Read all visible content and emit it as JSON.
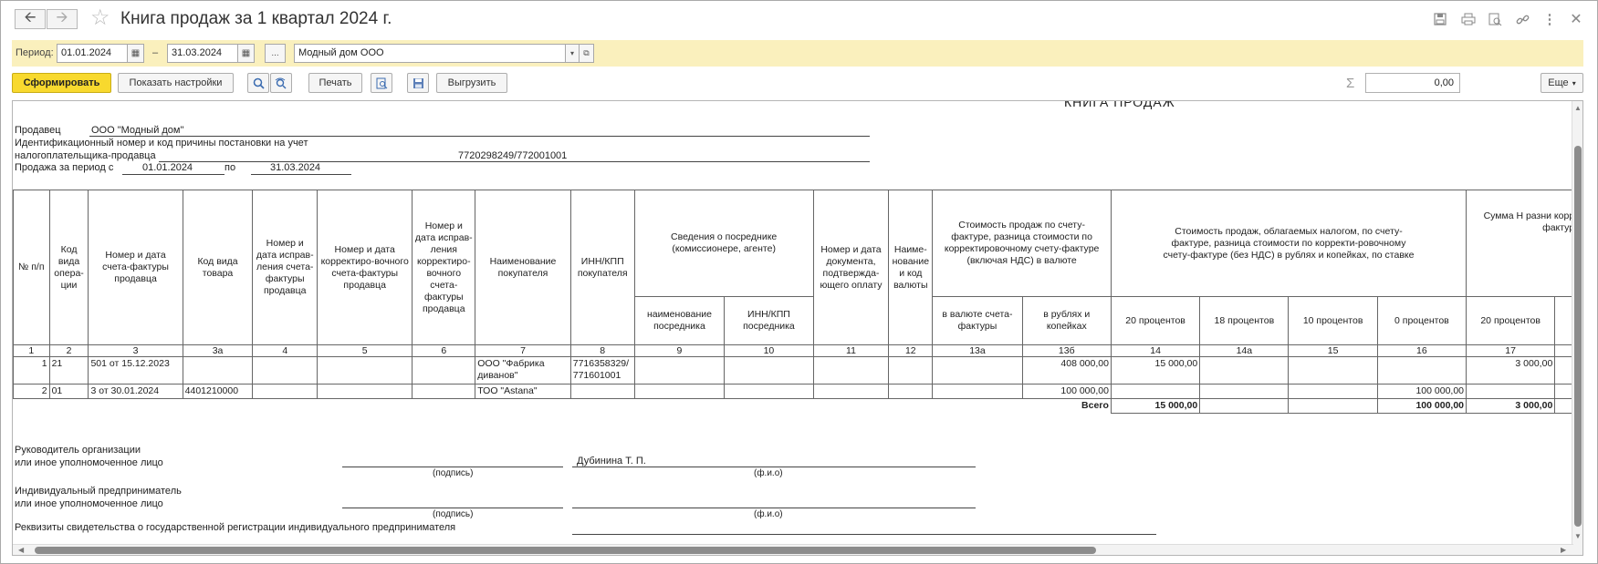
{
  "window": {
    "title": "Книга продаж за 1 квартал 2024 г."
  },
  "toolbar": {
    "back_icon": "arrow-left-icon",
    "forward_icon": "arrow-right-icon",
    "favorite_icon": "star-icon",
    "right_icons": [
      "save-icon",
      "print-icon",
      "preview-icon",
      "link-icon",
      "more-vertical-icon",
      "close-icon"
    ]
  },
  "period": {
    "label": "Период:",
    "from": "01.01.2024",
    "dash": "–",
    "to": "31.03.2024",
    "ellipsis": "...",
    "organization": "Модный дом ООО"
  },
  "actions": {
    "generate": "Сформировать",
    "show_settings": "Показать настройки",
    "print": "Печать",
    "export": "Выгрузить",
    "sum_value": "0,00",
    "more": "Еще"
  },
  "report": {
    "cut_title": "КНИГА ПРОДАЖ",
    "seller_label": "Продавец",
    "seller_value": "ООО \"Модный дом\"",
    "inn_label_1": "Идентификационный номер и код причины постановки на учет",
    "inn_label_2": "налогоплательщика-продавца",
    "inn_value": "7720298249/772001001",
    "period_label": "Продажа за период с",
    "period_from": "01.01.2024",
    "period_by": "по",
    "period_to": "31.03.2024",
    "headers": {
      "c1": "№ п/п",
      "c2": "Код вида опера-ции",
      "c3": "Номер и дата счета-фактуры продавца",
      "c3a": "Код вида товара",
      "c4": "Номер и дата исправ-ления счета-фактуры продавца",
      "c5": "Номер и дата корректиро-вочного счета-фактуры продавца",
      "c6": "Номер и дата исправ-ления корректиро-вочного счета-фактуры продавца",
      "c7": "Наименование покупателя",
      "c8": "ИНН/КПП покупателя",
      "c9_10": "Сведения о посреднике (комиссионере, агенте)",
      "c9": "наименование посредника",
      "c10": "ИНН/КПП посредника",
      "c11": "Номер и дата документа, подтвержда-ющего оплату",
      "c12": "Наиме-нование и код валюты",
      "c13": "Стоимость продаж по счету-фактуре, разница стоимости по корректировочному счету-фактуре (включая НДС) в валюте",
      "c13a": "в валюте счета-фактуры",
      "c13b": "в рублях и копейках",
      "c14_16": "Стоимость продаж, облагаемых налогом, по счету-фактуре, разница стоимости по корректи-ровочному счету-фактуре (без НДС) в рублях и копейках, по ставке",
      "c14": "20 процентов",
      "c14a": "18 процентов",
      "c15": "10 процентов",
      "c16": "0 процентов",
      "c17_group": "Сумма Н разни корре фактуре",
      "c17": "20 процентов"
    },
    "col_numbers": [
      "1",
      "2",
      "3",
      "3а",
      "4",
      "5",
      "6",
      "7",
      "8",
      "9",
      "10",
      "11",
      "12",
      "13а",
      "13б",
      "14",
      "14а",
      "15",
      "16",
      "17"
    ],
    "rows": [
      {
        "n": "1",
        "op": "21",
        "invoice": "501 от 15.12.2023",
        "code": "",
        "buyer": "ООО \"Фабрика диванов\"",
        "inn": "7716358329/ 771601001",
        "rub": "408 000,00",
        "p20": "15 000,00",
        "p0": "",
        "vat20": "3 000,00"
      },
      {
        "n": "2",
        "op": "01",
        "invoice": "3 от 30.01.2024",
        "code": "4401210000",
        "buyer": "ТОО \"Astana\"",
        "inn": "",
        "rub": "100 000,00",
        "p20": "",
        "p0": "100 000,00",
        "vat20": ""
      }
    ],
    "total": {
      "label": "Всего",
      "p20": "15 000,00",
      "p0": "100 000,00",
      "vat20": "3 000,00"
    },
    "signatures": {
      "head_1": "Руководитель организации",
      "head_2": "или иное уполномоченное лицо",
      "head_name": "Дубинина Т. П.",
      "podpis": "(подпись)",
      "fio": "(ф.и.о)",
      "ip_1": "Индивидуальный предприниматель",
      "ip_2": "или иное уполномоченное лицо",
      "rekv": "Реквизиты свидетельства о государственной регистрации индивидуального предпринимателя"
    }
  }
}
